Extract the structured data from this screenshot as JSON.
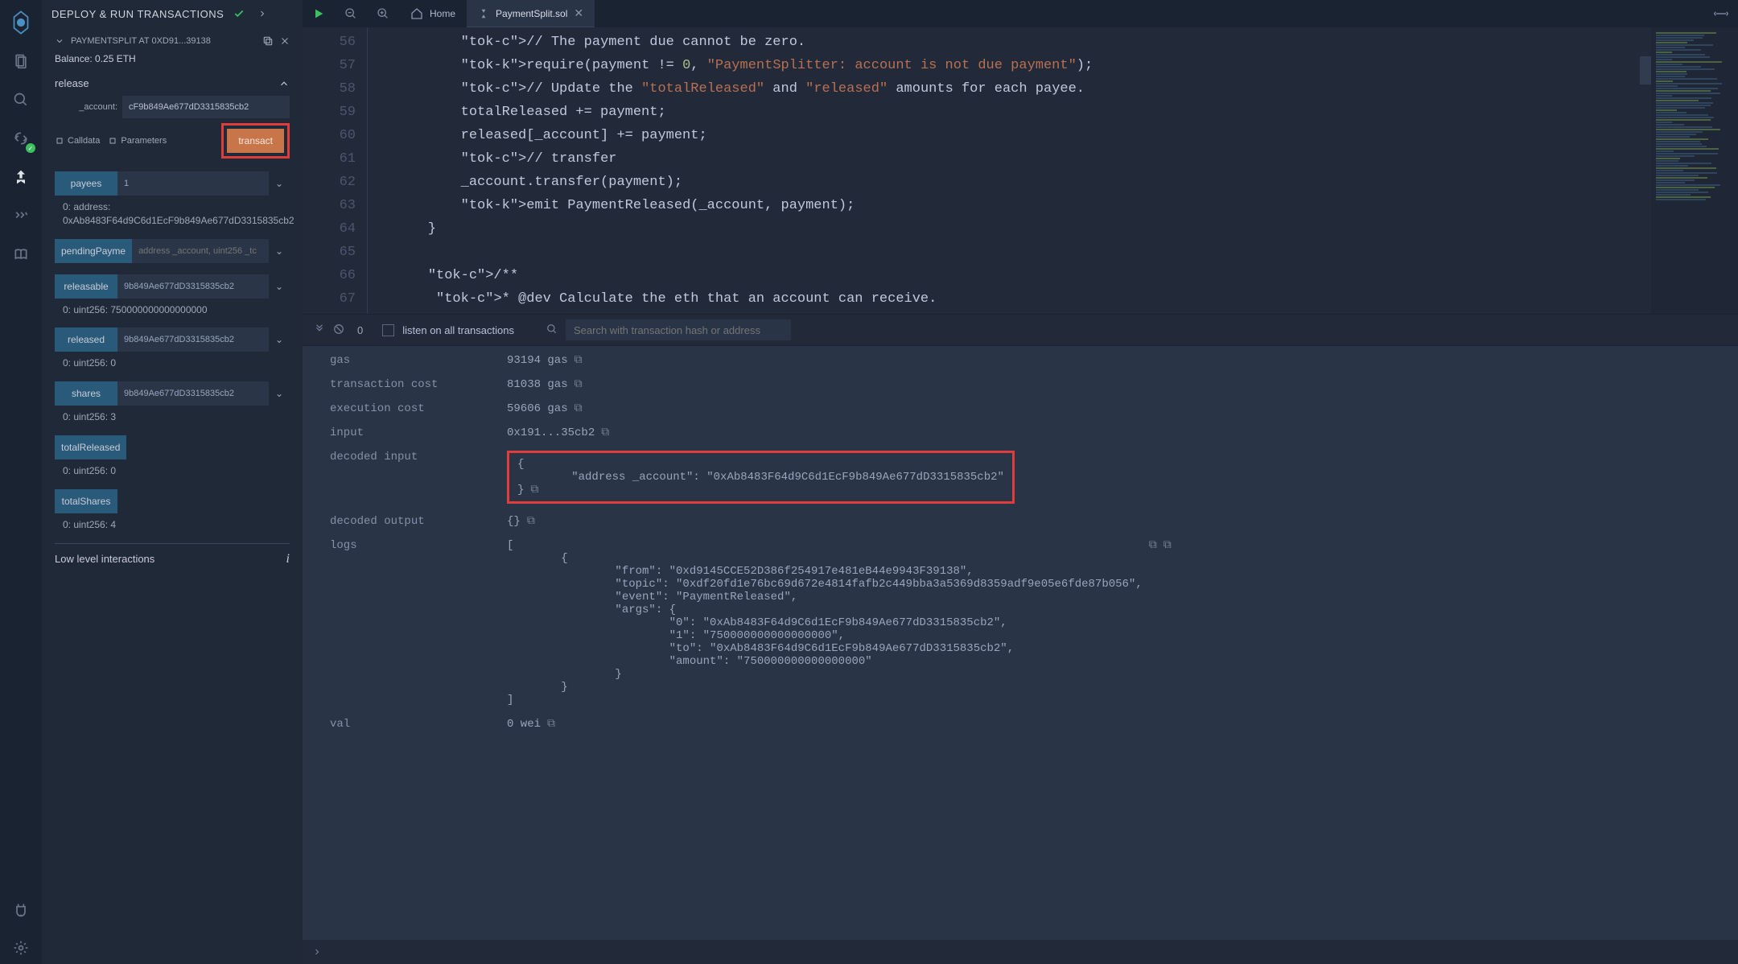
{
  "panel": {
    "title": "DEPLOY & RUN TRANSACTIONS",
    "contract_name": "PAYMENTSPLIT AT 0XD91...39138",
    "balance": "Balance: 0.25 ETH",
    "release": {
      "label": "release",
      "account_lbl": "_account:",
      "account_val": "cF9b849Ae677dD3315835cb2",
      "calldata": "Calldata",
      "parameters": "Parameters",
      "transact": "transact"
    },
    "fns": {
      "payees_lbl": "payees",
      "payees_in": "1",
      "payees_res": "0: address: 0xAb8483F64d9C6d1EcF9b849Ae677dD3315835cb2",
      "pending_lbl": "pendingPayme",
      "pending_ph": "address _account, uint256 _tc",
      "releasable_lbl": "releasable",
      "releasable_in": "9b849Ae677dD3315835cb2",
      "releasable_res": "0: uint256: 750000000000000000",
      "released_lbl": "released",
      "released_in": "9b849Ae677dD3315835cb2",
      "released_res": "0: uint256: 0",
      "shares_lbl": "shares",
      "shares_in": "9b849Ae677dD3315835cb2",
      "shares_res": "0: uint256: 3",
      "totalReleased_lbl": "totalReleased",
      "totalReleased_res": "0: uint256: 0",
      "totalShares_lbl": "totalShares",
      "totalShares_res": "0: uint256: 4"
    },
    "lli": "Low level interactions"
  },
  "tabs": {
    "home": "Home",
    "file": "PaymentSplit.sol"
  },
  "code": {
    "start": 56,
    "lines": [
      "        // The payment due cannot be zero.",
      "        require(payment != 0, \"PaymentSplitter: account is not due payment\");",
      "        // Update the \"totalReleased\" and \"released\" amounts for each payee.",
      "        totalReleased += payment;",
      "        released[_account] += payment;",
      "        // transfer",
      "        _account.transfer(payment);",
      "        emit PaymentReleased(_account, payment);",
      "    }",
      "",
      "    /**",
      "     * @dev Calculate the eth that an account can receive."
    ]
  },
  "terminal": {
    "count": "0",
    "listen": "listen on all transactions",
    "search_ph": "Search with transaction hash or address",
    "rows": {
      "gas_k": "gas",
      "gas_v": "93194 gas",
      "txc_k": "transaction cost",
      "txc_v": "81038 gas",
      "exc_k": "execution cost",
      "exc_v": "59606 gas",
      "in_k": "input",
      "in_v": "0x191...35cb2",
      "din_k": "decoded input",
      "din_v": "{\n        \"address _account\": \"0xAb8483F64d9C6d1EcF9b849Ae677dD3315835cb2\"\n}",
      "dout_k": "decoded output",
      "dout_v": "{}",
      "logs_k": "logs",
      "logs_v": "[\n        {\n                \"from\": \"0xd9145CCE52D386f254917e481eB44e9943F39138\",\n                \"topic\": \"0xdf20fd1e76bc69d672e4814fafb2c449bba3a5369d8359adf9e05e6fde87b056\",\n                \"event\": \"PaymentReleased\",\n                \"args\": {\n                        \"0\": \"0xAb8483F64d9C6d1EcF9b849Ae677dD3315835cb2\",\n                        \"1\": \"750000000000000000\",\n                        \"to\": \"0xAb8483F64d9C6d1EcF9b849Ae677dD3315835cb2\",\n                        \"amount\": \"750000000000000000\"\n                }\n        }\n]",
      "val_k": "val",
      "val_v": "0 wei"
    }
  }
}
